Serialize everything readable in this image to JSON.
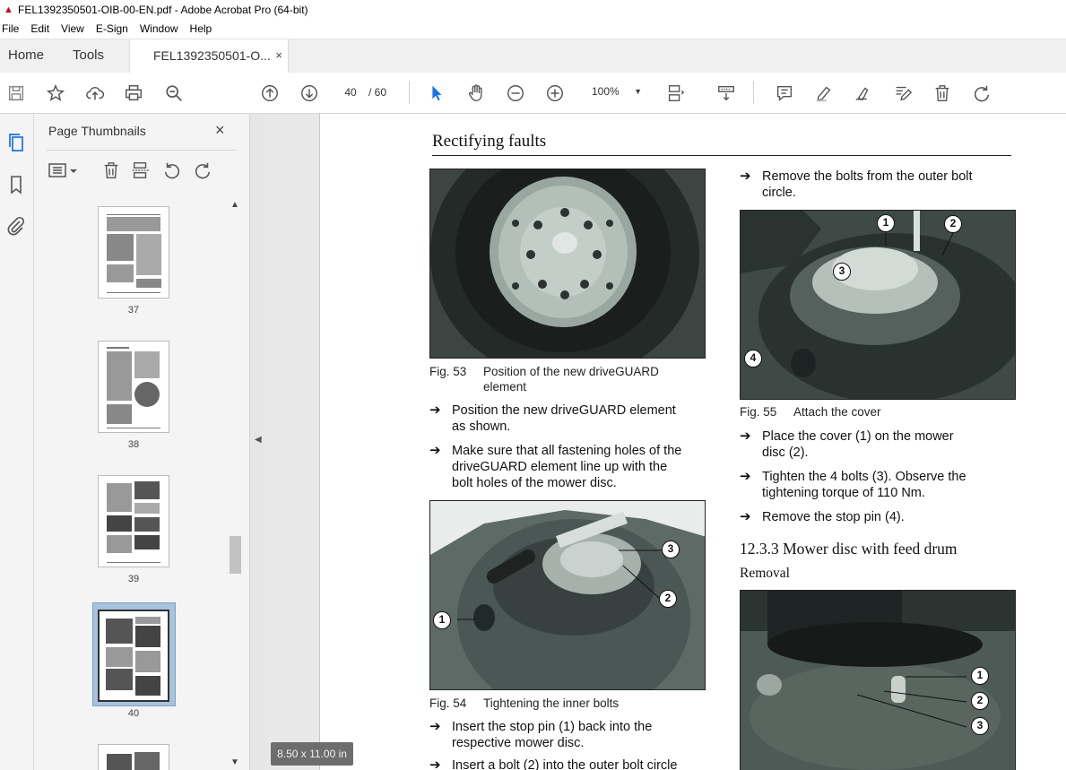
{
  "window": {
    "title": "FEL1392350501-OIB-00-EN.pdf - Adobe Acrobat Pro (64-bit)"
  },
  "menu": [
    "File",
    "Edit",
    "View",
    "E-Sign",
    "Window",
    "Help"
  ],
  "tabs": {
    "home": "Home",
    "tools": "Tools",
    "document": "FEL1392350501-O...",
    "close": "×"
  },
  "toolbar": {
    "current_page": "40",
    "total_pages": "/ 60",
    "zoom": "100%"
  },
  "thumbnails": {
    "title": "Page Thumbnails",
    "close": "×",
    "pages": [
      {
        "label": "37"
      },
      {
        "label": "38"
      },
      {
        "label": "39"
      },
      {
        "label": "40",
        "selected": true
      }
    ]
  },
  "status": {
    "page_size": "8.50 x 11.00 in"
  },
  "document": {
    "heading": "Rectifying faults",
    "fig53": {
      "num": "Fig. 53",
      "caption_line1": "Position of the new driveGUARD",
      "caption_line2": "element"
    },
    "fig54": {
      "num": "Fig. 54",
      "caption": "Tightening the inner bolts"
    },
    "fig55": {
      "num": "Fig. 55",
      "caption": "Attach the cover"
    },
    "left_steps": [
      {
        "line1": "Position the new driveGUARD element",
        "line2": "as shown."
      },
      {
        "line1": "Make sure that all fastening holes of the",
        "line2": "driveGUARD element line up with the",
        "line3": "bolt holes of the mower disc."
      },
      {
        "line1": "Insert the stop pin (1) back into the",
        "line2": "respective mower disc."
      },
      {
        "line1": "Insert a bolt (2) into the outer bolt circle"
      }
    ],
    "right_steps": [
      {
        "line1": "Remove the bolts from the outer bolt",
        "line2": "circle."
      },
      {
        "line1": "Place the cover (1) on the mower",
        "line2": "disc (2)."
      },
      {
        "line1": "Tighten the 4 bolts (3). Observe the",
        "line2": "tightening torque of 110 Nm."
      },
      {
        "line1": "Remove the stop pin (4)."
      }
    ],
    "subsection": "12.3.3 Mower disc with feed drum",
    "subsubsection": "Removal",
    "callouts": {
      "c1": "1",
      "c2": "2",
      "c3": "3",
      "c4": "4"
    }
  },
  "colors": {
    "accent": "#1473e6",
    "photo_bg": "#4a5652"
  }
}
